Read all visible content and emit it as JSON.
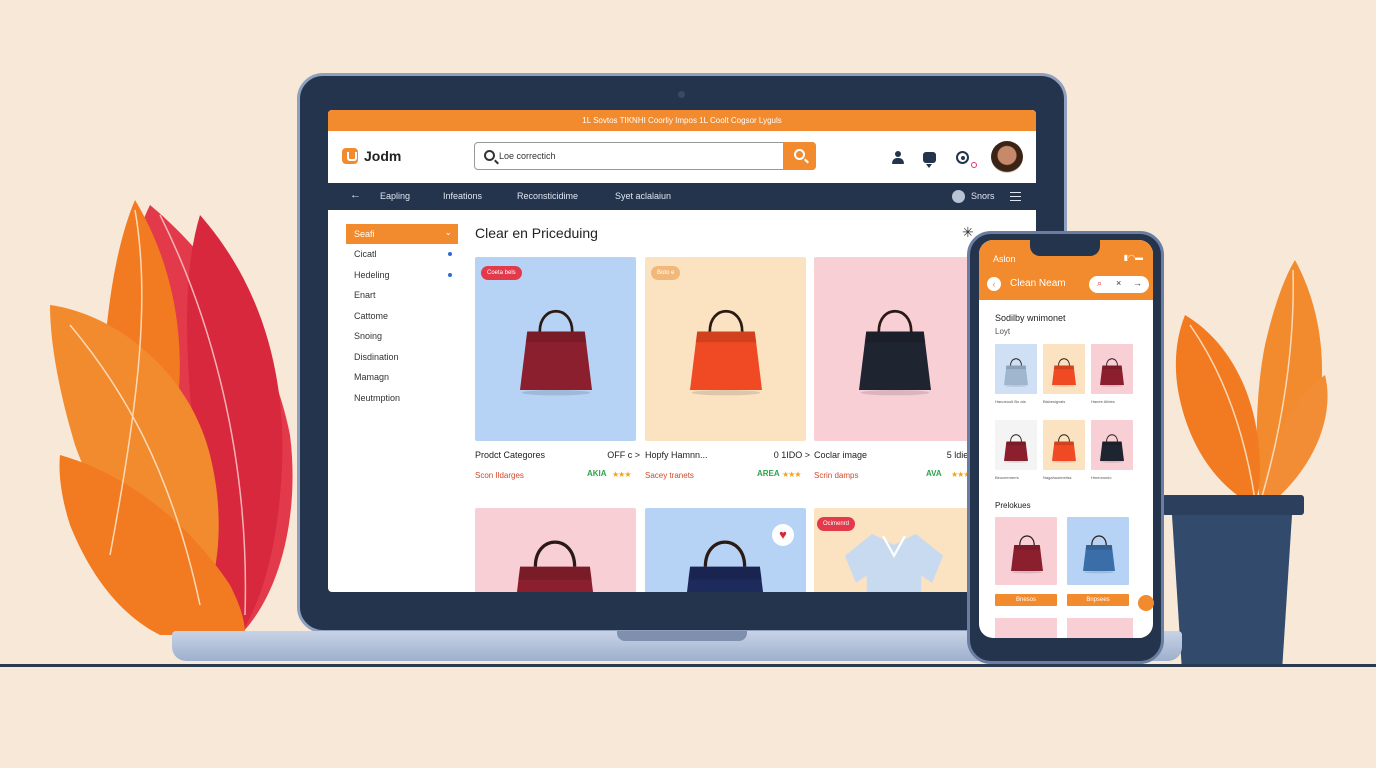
{
  "promo_banner": "1L Sovtos TIKNHI Coorliy Impos  1L Coolt Cogsor Lyguls",
  "header": {
    "logo_text": "Jodm",
    "search": {
      "value": "Loe correctich",
      "placeholder": "Loe correctich"
    }
  },
  "nav": {
    "back_icon": "arrow-left-icon",
    "items": [
      "Eapling",
      "Infeations",
      "Reconsticidime",
      "Syet aclalaiun"
    ],
    "right_label": "Snors"
  },
  "sidebar": {
    "items": [
      {
        "label": "Seafi",
        "active": true
      },
      {
        "label": "Cicatl",
        "dot": true
      },
      {
        "label": "Hedeling",
        "dot": true
      },
      {
        "label": "Enart"
      },
      {
        "label": "Cattome"
      },
      {
        "label": "Snoing"
      },
      {
        "label": "Disdination"
      },
      {
        "label": "Mamagn"
      },
      {
        "label": "Neutmption"
      }
    ]
  },
  "section_title": "Clear en Priceduing",
  "products": [
    {
      "name": "Prodct Categores",
      "price": "OFF c  >",
      "sub": "Scon Ildarges",
      "rating": "AKIA",
      "badge": "Coeta bels",
      "bg": "#b6d3f5",
      "bag": "#8b1f2e"
    },
    {
      "name": "Hopfy Hamnn...",
      "price": "0 1IDO  >",
      "sub": "Sacey tranets",
      "rating": "AREA",
      "badge": "Boto e",
      "bg": "#fbe3c2",
      "bag": "#ef4a23"
    },
    {
      "name": "Coclar image",
      "price": "5 ldier  >",
      "sub": "Scrin damps",
      "rating": "AVA",
      "badge": "",
      "bg": "#f9cfd6",
      "bag": "#1e2430"
    }
  ],
  "products_row2": [
    {
      "badge": "",
      "bg": "#f9cfd6",
      "bag": "#8b1f2e"
    },
    {
      "badge": "",
      "bg": "#b6d3f5",
      "bag": "#1d2b5c"
    },
    {
      "badge": "Ocimenrd",
      "bg": "#fbe3c2",
      "bag": "#c8daef"
    }
  ],
  "phone": {
    "status_left": "Aslon",
    "title": "Clean Neam",
    "section1_title": "Sodilby wnimonet",
    "section1_sub": "Loyt",
    "grid": [
      {
        "bg": "#cfe0f4",
        "color": "#9fb6cf",
        "caption": "Hanoeoult Bo ats"
      },
      {
        "bg": "#fbe3c2",
        "color": "#ef4a23",
        "caption": "Bisbesigvals"
      },
      {
        "bg": "#f9cfd6",
        "color": "#8b1f2e",
        "caption": "Hanee Atbies"
      },
      {
        "bg": "#f4f4f4",
        "color": "#8b1f2e",
        "caption": "Beoceemerrs"
      },
      {
        "bg": "#fbe3c2",
        "color": "#ef4a23",
        "caption": "Nagahuoimeiiss"
      },
      {
        "bg": "#f9cfd6",
        "color": "#1e2430",
        "caption": "Hmeunonio"
      }
    ],
    "section2_title": "Prelokues",
    "featured": [
      {
        "bg": "#f9cfd6",
        "color": "#8b1f2e",
        "button": "Bnesos"
      },
      {
        "bg": "#b6d3f5",
        "color": "#3a6ea8",
        "button": "Bnpsees"
      }
    ]
  },
  "colors": {
    "accent": "#f28a2e",
    "navy": "#24344c",
    "background": "#f8e8d8"
  }
}
